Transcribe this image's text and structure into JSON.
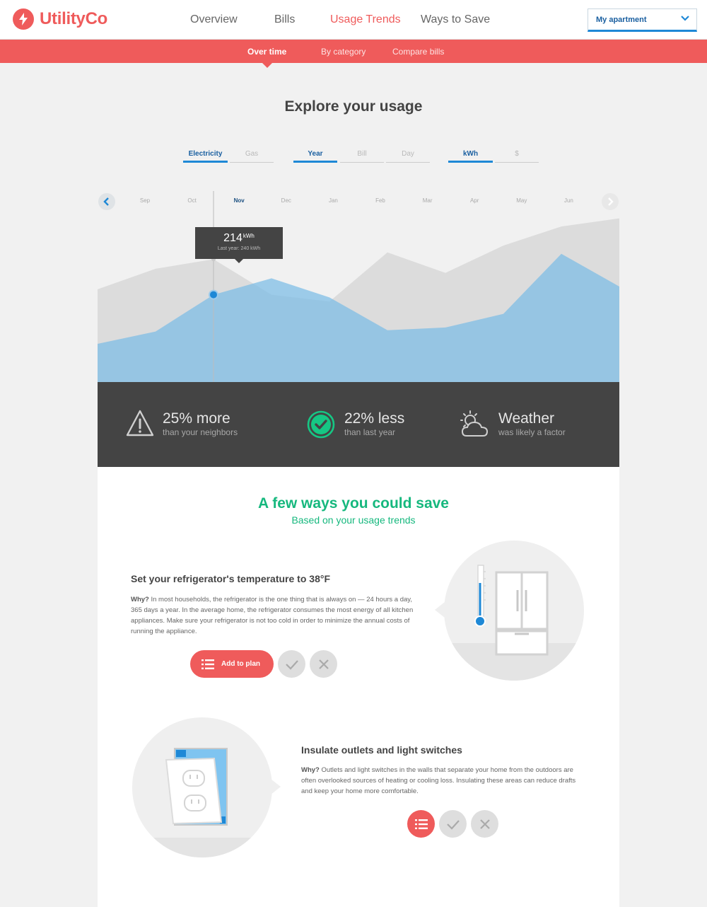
{
  "brand": {
    "name": "UtilityCo"
  },
  "nav": {
    "items": [
      {
        "label": "Overview",
        "active": false
      },
      {
        "label": "Bills",
        "active": false
      },
      {
        "label": "Usage Trends",
        "active": true
      },
      {
        "label": "Ways to Save",
        "active": false
      }
    ],
    "account_select": "My apartment"
  },
  "subnav": {
    "items": [
      {
        "label": "Over time",
        "active": true
      },
      {
        "label": "By category",
        "active": false
      },
      {
        "label": "Compare bills",
        "active": false
      }
    ]
  },
  "page_title": "Explore your usage",
  "filters": {
    "fuel": [
      "Electricity",
      "Gas"
    ],
    "period": [
      "Year",
      "Bill",
      "Day"
    ],
    "unit": [
      "kWh",
      "$"
    ],
    "selected": {
      "fuel": "Electricity",
      "period": "Year",
      "unit": "kWh"
    }
  },
  "chart_data": {
    "type": "area",
    "categories": [
      "Sep",
      "Oct",
      "Nov",
      "Dec",
      "Jan",
      "Feb",
      "Mar",
      "Apr",
      "May",
      "Jun"
    ],
    "selected_category": "Nov",
    "series": [
      {
        "role": "last_year",
        "values": [
          218,
          233,
          240,
          214,
          209,
          245,
          230,
          250,
          264,
          270
        ],
        "color": "#dcdcdc"
      },
      {
        "role": "this_year",
        "values": [
          178,
          187,
          214,
          226,
          212,
          188,
          190,
          200,
          244,
          220
        ],
        "color": "#7fbee6"
      }
    ],
    "tooltip": {
      "value": "214",
      "unit": "kWh",
      "note": "Last year: 240 kWh"
    }
  },
  "stats": [
    {
      "icon": "warning-icon",
      "big": "25% more",
      "small": "than your neighbors"
    },
    {
      "icon": "check-circle-icon",
      "big": "22% less",
      "small": "than last year"
    },
    {
      "icon": "weather-icon",
      "big": "Weather",
      "small": "was likely a factor"
    }
  ],
  "savings": {
    "title": "A few ways you could save",
    "subtitle": "Based on your usage trends",
    "tips": [
      {
        "title": "Set your refrigerator's temperature to 38°F",
        "why": "Why?",
        "body": " In most households, the refrigerator is the one thing that is always on — 24 hours a day, 365 days a year. In the average home, the refrigerator consumes the most energy of all kitchen appliances. Make sure your refrigerator is not too cold in order to minimize the annual costs of running the appliance.",
        "add_label": "Add to plan"
      },
      {
        "title": "Insulate outlets and light switches",
        "why": "Why?",
        "body": " Outlets and light switches in the walls that separate your home from the outdoors are often overlooked sources of heating or cooling loss. Insulating these areas can reduce drafts and keep your home more comfortable."
      }
    ]
  },
  "colors": {
    "accent": "#ef5b5b",
    "blue": "#1e88d6",
    "green": "#16b87e",
    "dark": "#444444"
  }
}
